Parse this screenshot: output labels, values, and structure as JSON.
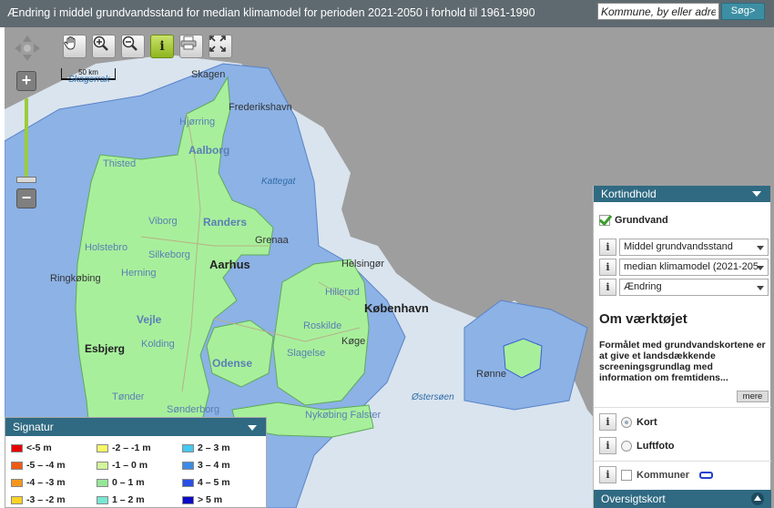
{
  "header": {
    "title": "Ændring i middel grundvandsstand for median klimamodel for perioden 2021-2050 i forhold til 1961-1990",
    "search_value": "Kommune, by eller adre",
    "search_button": "Søg>"
  },
  "map": {
    "scalebar": "50 km",
    "labels": {
      "skagerrak": "Skagerrak",
      "skagen": "Skagen",
      "frederikshavn": "Frederikshavn",
      "hjorring": "Hjørring",
      "aalborg": "Aalborg",
      "thisted": "Thisted",
      "kattegat": "Kattegat",
      "viborg": "Viborg",
      "randers": "Randers",
      "holstebro": "Holstebro",
      "grenaa": "Grenaa",
      "silkeborg": "Silkeborg",
      "aarhus": "Aarhus",
      "herning": "Herning",
      "ringkobing": "Ringkøbing",
      "helsingor": "Helsingør",
      "hillerod": "Hillerød",
      "kobenhavn": "København",
      "roskilde": "Roskilde",
      "vejle": "Vejle",
      "kolding": "Kolding",
      "esbjerg": "Esbjerg",
      "koge": "Køge",
      "slagelse": "Slagelse",
      "odense": "Odense",
      "ronne": "Rønne",
      "ostersoen": "Østersøen",
      "nykobing": "Nykøbing Falster",
      "sonderborg": "Sønderborg",
      "tonder": "Tønder"
    }
  },
  "panel": {
    "header": "Kortindhold",
    "layer_label": "Grundvand",
    "select1": "Middel grundvandsstand",
    "select2": "median klimamodel (2021-205",
    "select3": "Ændring",
    "info_glyph": "i",
    "about_title": "Om værktøjet",
    "about_text": "Formålet med grundvandskortene er at give et landsdækkende screeningsgrundlag med information om fremtidens...",
    "more_button": "mere",
    "radio_kort": "Kort",
    "radio_luftfoto": "Luftfoto",
    "kommuner": "Kommuner",
    "overview": "Oversigtskort"
  },
  "legend": {
    "title": "Signatur",
    "items": [
      {
        "label": "<-5 m",
        "color": "#e60000"
      },
      {
        "label": "-5 – -4 m",
        "color": "#f05a14"
      },
      {
        "label": "-4 – -3 m",
        "color": "#f5961e"
      },
      {
        "label": "-3 – -2 m",
        "color": "#fad228"
      },
      {
        "label": "-2 – -1 m",
        "color": "#f8f866"
      },
      {
        "label": "-1 – 0 m",
        "color": "#d2f59a"
      },
      {
        "label": "0 – 1 m",
        "color": "#96e696"
      },
      {
        "label": "1 – 2 m",
        "color": "#78e6d2"
      },
      {
        "label": "2 – 3 m",
        "color": "#46c8f0"
      },
      {
        "label": "3 – 4 m",
        "color": "#3c8ce6"
      },
      {
        "label": "4 – 5 m",
        "color": "#2850e6"
      },
      {
        "label": "> 5 m",
        "color": "#0a0ac8"
      }
    ]
  }
}
